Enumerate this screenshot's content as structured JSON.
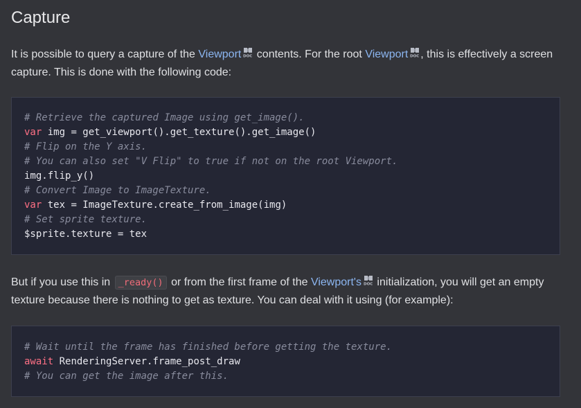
{
  "heading": "Capture",
  "paragraph1": {
    "part1": "It is possible to query a capture of the ",
    "link1": "Viewport",
    "part2": " contents. For the root ",
    "link2": "Viewport",
    "part3": ", this is effectively a screen capture. This is done with the following code:"
  },
  "code1": {
    "lines": [
      [
        {
          "t": "# Retrieve the captured Image using get_image().",
          "k": "comment"
        }
      ],
      [
        {
          "t": "var",
          "k": "keyword"
        },
        {
          "t": " img = get_viewport().get_texture().get_image()",
          "k": "plain"
        }
      ],
      [
        {
          "t": "# Flip on the Y axis.",
          "k": "comment"
        }
      ],
      [
        {
          "t": "# You can also set \"V Flip\" to true if not on the root Viewport.",
          "k": "comment"
        }
      ],
      [
        {
          "t": "img.flip_y()",
          "k": "plain"
        }
      ],
      [
        {
          "t": "# Convert Image to ImageTexture.",
          "k": "comment"
        }
      ],
      [
        {
          "t": "var",
          "k": "keyword"
        },
        {
          "t": " tex = ImageTexture.create_from_image(img)",
          "k": "plain"
        }
      ],
      [
        {
          "t": "# Set sprite texture.",
          "k": "comment"
        }
      ],
      [
        {
          "t": "$sprite.texture = tex",
          "k": "plain"
        }
      ]
    ]
  },
  "paragraph2": {
    "part1": "But if you use this in ",
    "code": "_ready()",
    "part2": " or from the first frame of the ",
    "link": "Viewport's",
    "part3": " initialization, you will get an empty texture because there is nothing to get as texture. You can deal with it using (for example):"
  },
  "code2": {
    "lines": [
      [
        {
          "t": "# Wait until the frame has finished before getting the texture.",
          "k": "comment"
        }
      ],
      [
        {
          "t": "await",
          "k": "keyword"
        },
        {
          "t": " RenderingServer.frame_post_draw",
          "k": "plain"
        }
      ],
      [
        {
          "t": "# You can get the image after this.",
          "k": "comment"
        }
      ]
    ]
  },
  "icons": {
    "doc": "doc-book-icon"
  },
  "colors": {
    "background": "#333439",
    "link": "#8cb6f1",
    "code_bg": "#242634",
    "keyword": "#ff7085",
    "comment": "#898c9d",
    "inline_code": "#f06c79"
  }
}
